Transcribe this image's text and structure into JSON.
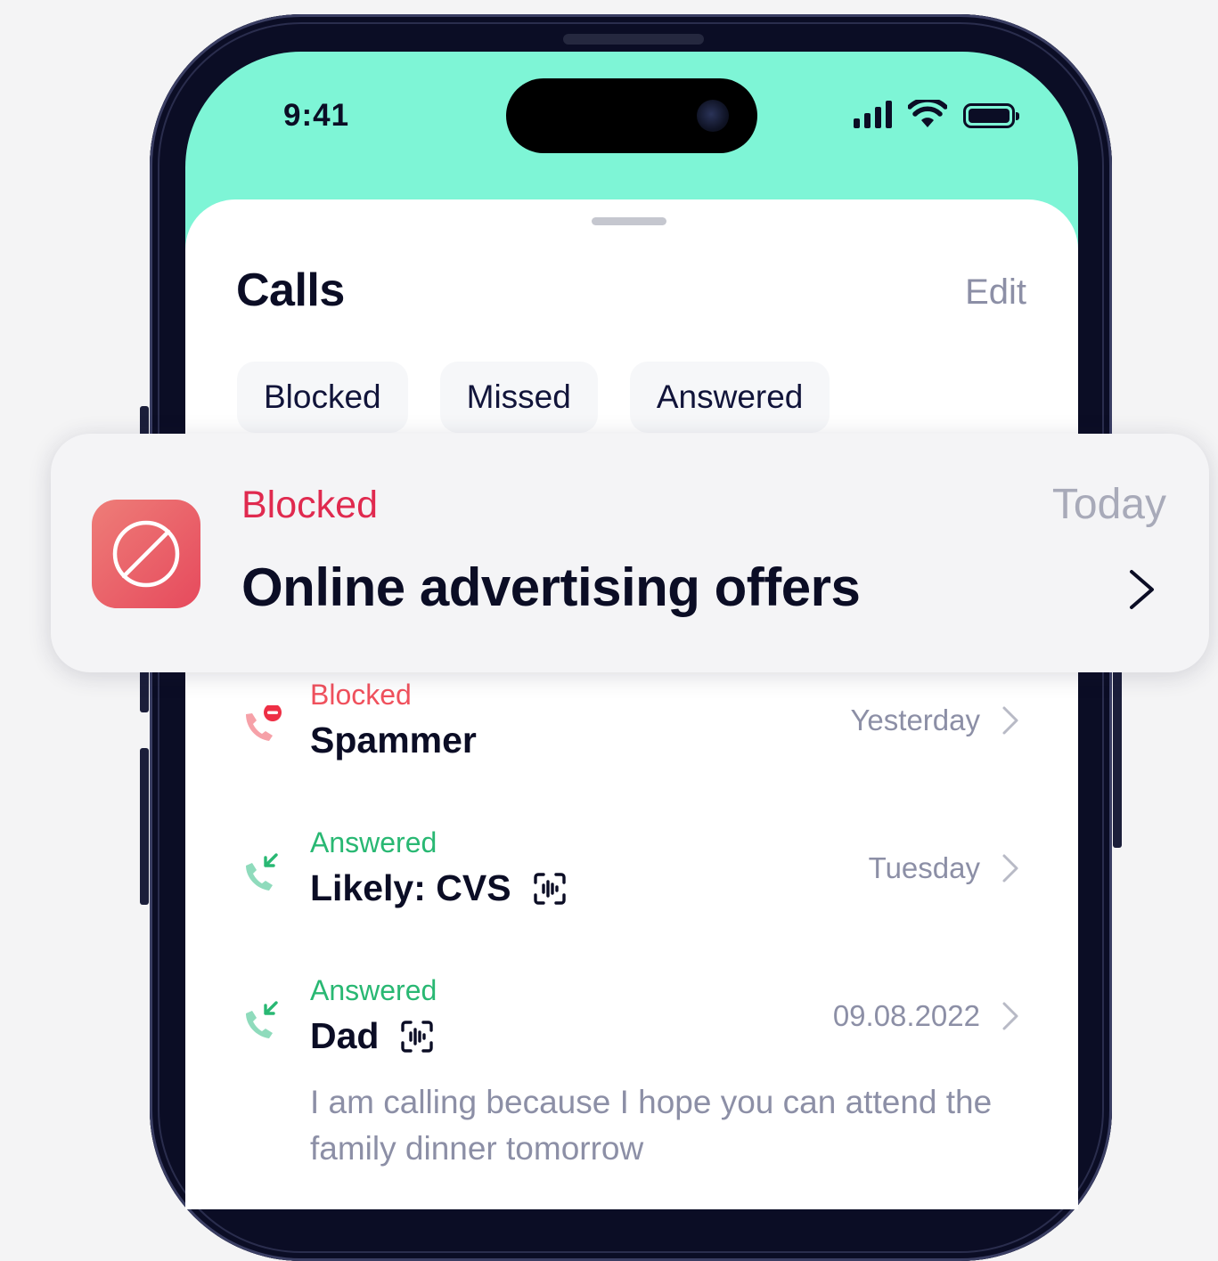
{
  "status_bar": {
    "time": "9:41"
  },
  "header": {
    "title": "Calls",
    "edit_label": "Edit"
  },
  "filters": [
    "Blocked",
    "Missed",
    "Answered"
  ],
  "notification": {
    "category": "Blocked",
    "time": "Today",
    "title": "Online advertising offers",
    "icon": "block-icon",
    "colors": {
      "category": "#e02a4f",
      "icon_gradient_start": "#ee7d78",
      "icon_gradient_end": "#e64a5d"
    }
  },
  "calls": [
    {
      "status": "Blocked",
      "status_color": "#f0515d",
      "name": "Spammer",
      "when": "Yesterday",
      "icon": "blocked-call-icon"
    },
    {
      "status": "Answered",
      "status_color": "#29b873",
      "name": "Likely: CVS",
      "when": "Tuesday",
      "icon": "incoming-call-icon",
      "badge": "voice-transcript-icon"
    },
    {
      "status": "Answered",
      "status_color": "#29b873",
      "name": "Dad",
      "when": "09.08.2022",
      "icon": "incoming-call-icon",
      "badge": "voice-transcript-icon",
      "preview": "I am calling because I hope you can attend the family dinner tomorrow"
    }
  ],
  "colors": {
    "accent_mint": "#7ef5d6",
    "text_dark": "#0b0d25",
    "text_muted": "#8c8fa6"
  }
}
